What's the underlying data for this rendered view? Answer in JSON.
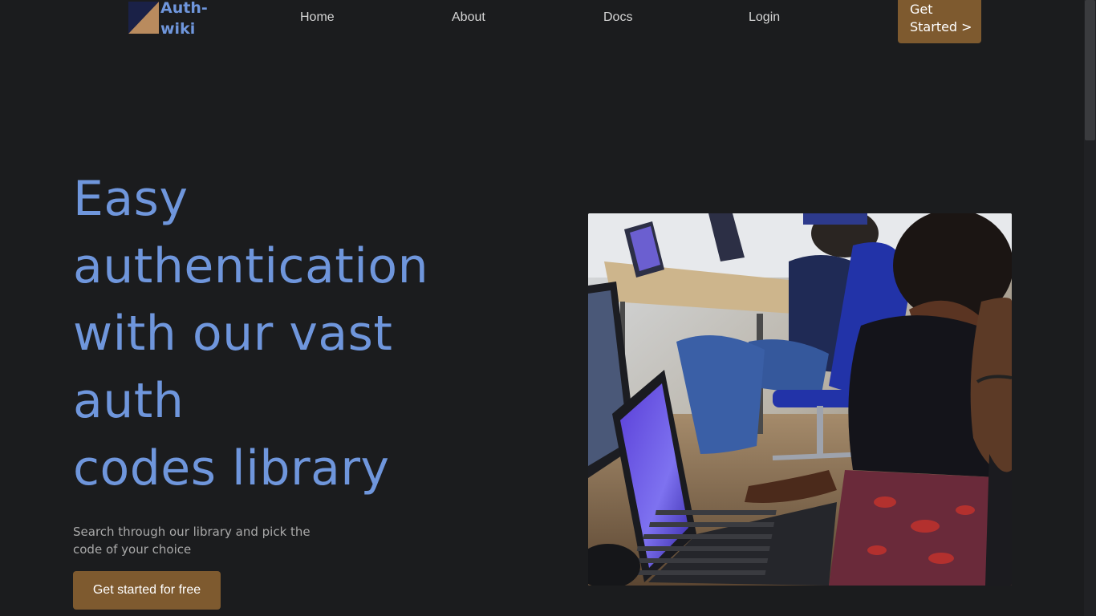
{
  "brand": {
    "name_line1": "Auth-",
    "name_line2": "wiki",
    "mark_icon": "triangle-logo-icon"
  },
  "nav": {
    "items": [
      {
        "label": "Home"
      },
      {
        "label": "About"
      },
      {
        "label": "Docs"
      },
      {
        "label": "Login"
      }
    ],
    "cta_line1": "Get",
    "cta_line2": "Started >"
  },
  "hero": {
    "title_lines": [
      "Easy",
      "authentication",
      "with our vast",
      "auth",
      "codes library"
    ],
    "subtitle": "Search through our library and pick the code of your choice",
    "cta_label": "Get started for free",
    "photo_icon": "people-at-laptops-photo"
  },
  "colors": {
    "background": "#1b1c1e",
    "accent_blue": "#6f96dc",
    "brand_brown": "#7e5a2f",
    "nav_text": "#d5d5d5",
    "muted_text": "#a9a9a9"
  }
}
